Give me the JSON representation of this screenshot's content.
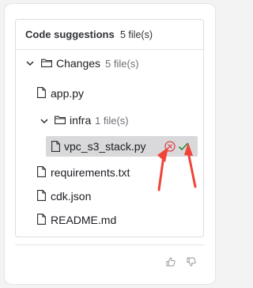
{
  "header": {
    "title": "Code suggestions",
    "count": "5 file(s)"
  },
  "tree": {
    "changes": {
      "label": "Changes",
      "count": "5 file(s)"
    },
    "app": {
      "label": "app.py"
    },
    "infra": {
      "label": "infra",
      "count": "1 file(s)"
    },
    "vpc": {
      "label": "vpc_s3_stack.py"
    },
    "requirements": {
      "label": "requirements.txt"
    },
    "cdk": {
      "label": "cdk.json"
    },
    "readme": {
      "label": "README.md"
    }
  },
  "colors": {
    "reject": "#e0474c",
    "accept": "#2e8540",
    "annotation_arrow": "#f04438",
    "selected_bg": "#d9d9db"
  },
  "icons": [
    "chevron-down-icon",
    "folder-icon",
    "file-icon",
    "reject-circle-x-icon",
    "accept-check-icon",
    "thumbs-up-icon",
    "thumbs-down-icon"
  ]
}
